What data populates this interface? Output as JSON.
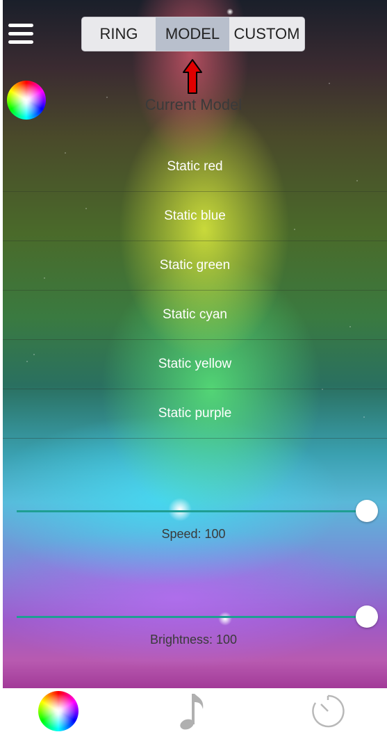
{
  "header": {
    "tabs": [
      {
        "label": "RING",
        "active": false
      },
      {
        "label": "MODEL",
        "active": true
      },
      {
        "label": "CUSTOM",
        "active": false
      }
    ],
    "menu_icon": "hamburger-menu-icon",
    "annotation_arrow_color": "#e00000"
  },
  "color_wheel_icon": "color-wheel-icon",
  "current_model_label": "Current Model",
  "models": [
    {
      "label": "Static red"
    },
    {
      "label": "Static blue"
    },
    {
      "label": "Static green"
    },
    {
      "label": "Static cyan"
    },
    {
      "label": "Static yellow"
    },
    {
      "label": "Static purple"
    }
  ],
  "sliders": {
    "speed": {
      "label": "Speed: 100",
      "value": 100,
      "max": 100
    },
    "brightness": {
      "label": "Brightness: 100",
      "value": 100,
      "max": 100
    }
  },
  "bottom_nav": [
    {
      "icon": "color-wheel-icon",
      "active": true
    },
    {
      "icon": "music-note-icon",
      "active": false
    },
    {
      "icon": "timer-icon",
      "active": false
    }
  ],
  "colors": {
    "slider_track": "#1f9e93",
    "segment_active_bg": "#b8bfcc"
  }
}
